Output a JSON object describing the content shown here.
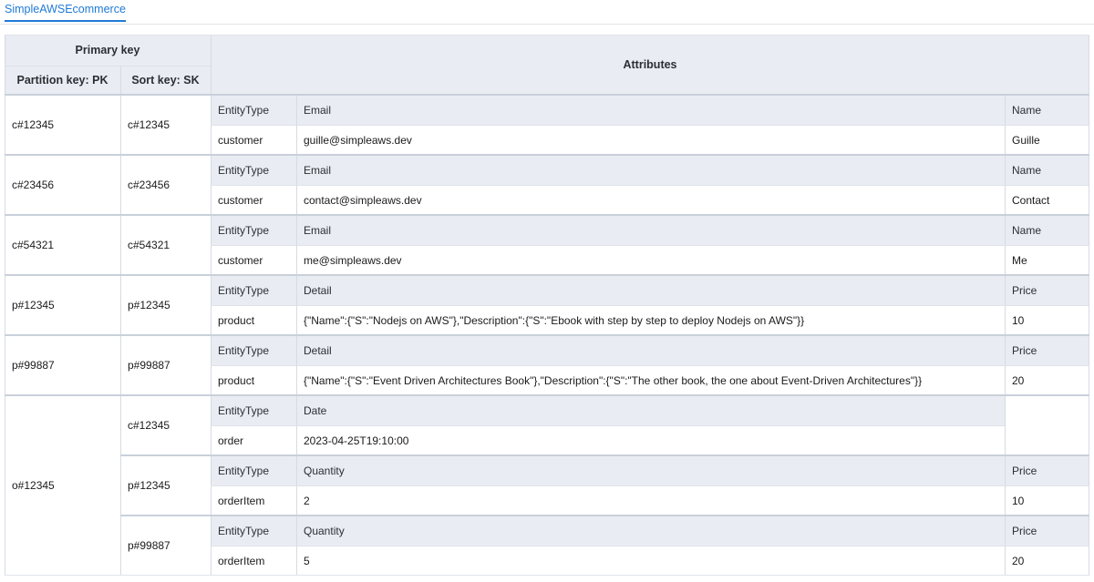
{
  "tab": {
    "label": "SimpleAWSEcommerce"
  },
  "header": {
    "primary_key": "Primary key",
    "partition_key": "Partition key: PK",
    "sort_key": "Sort key: SK",
    "attributes": "Attributes"
  },
  "items": [
    {
      "pk": "c#12345",
      "sk": "c#12345",
      "headers": [
        "EntityType",
        "Email",
        "Name"
      ],
      "values": [
        "customer",
        "guille@simpleaws.dev",
        "Guille"
      ]
    },
    {
      "pk": "c#23456",
      "sk": "c#23456",
      "headers": [
        "EntityType",
        "Email",
        "Name"
      ],
      "values": [
        "customer",
        "contact@simpleaws.dev",
        "Contact"
      ]
    },
    {
      "pk": "c#54321",
      "sk": "c#54321",
      "headers": [
        "EntityType",
        "Email",
        "Name"
      ],
      "values": [
        "customer",
        "me@simpleaws.dev",
        "Me"
      ]
    },
    {
      "pk": "p#12345",
      "sk": "p#12345",
      "headers": [
        "EntityType",
        "Detail",
        "Price"
      ],
      "values": [
        "product",
        "{\"Name\":{\"S\":\"Nodejs on AWS\"},\"Description\":{\"S\":\"Ebook with step by step to deploy Nodejs on AWS\"}}",
        "10"
      ]
    },
    {
      "pk": "p#99887",
      "sk": "p#99887",
      "headers": [
        "EntityType",
        "Detail",
        "Price"
      ],
      "values": [
        "product",
        "{\"Name\":{\"S\":\"Event Driven Architectures Book\"},\"Description\":{\"S\":\"The other book, the one about Event-Driven Architectures\"}}",
        "20"
      ]
    },
    {
      "pk": "o#12345",
      "sk": "c#12345",
      "headers": [
        "EntityType",
        "Date"
      ],
      "values": [
        "order",
        "2023-04-25T19:10:00"
      ]
    },
    {
      "pk": "o#12345",
      "sk": "p#12345",
      "headers": [
        "EntityType",
        "Quantity",
        "Price"
      ],
      "values": [
        "orderItem",
        "2",
        "10"
      ]
    },
    {
      "pk": "o#12345",
      "sk": "p#99887",
      "headers": [
        "EntityType",
        "Quantity",
        "Price"
      ],
      "values": [
        "orderItem",
        "5",
        "20"
      ]
    }
  ]
}
